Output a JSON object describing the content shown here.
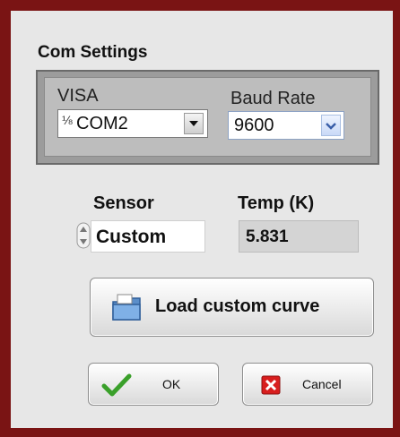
{
  "com_settings": {
    "title": "Com Settings",
    "visa": {
      "label": "VISA",
      "value": "COM2"
    },
    "baud_rate": {
      "label": "Baud Rate",
      "value": "9600"
    }
  },
  "sensor": {
    "label": "Sensor",
    "value": "Custom"
  },
  "temperature": {
    "label": "Temp (K)",
    "value": "5.831"
  },
  "buttons": {
    "load_curve": "Load custom curve",
    "ok": "OK",
    "cancel": "Cancel"
  },
  "colors": {
    "frame": "#7a1414",
    "panel": "#e7e7e7",
    "group": "#9c9c9c",
    "ok_check": "#3aa02a",
    "cancel_x": "#d81e1e"
  }
}
